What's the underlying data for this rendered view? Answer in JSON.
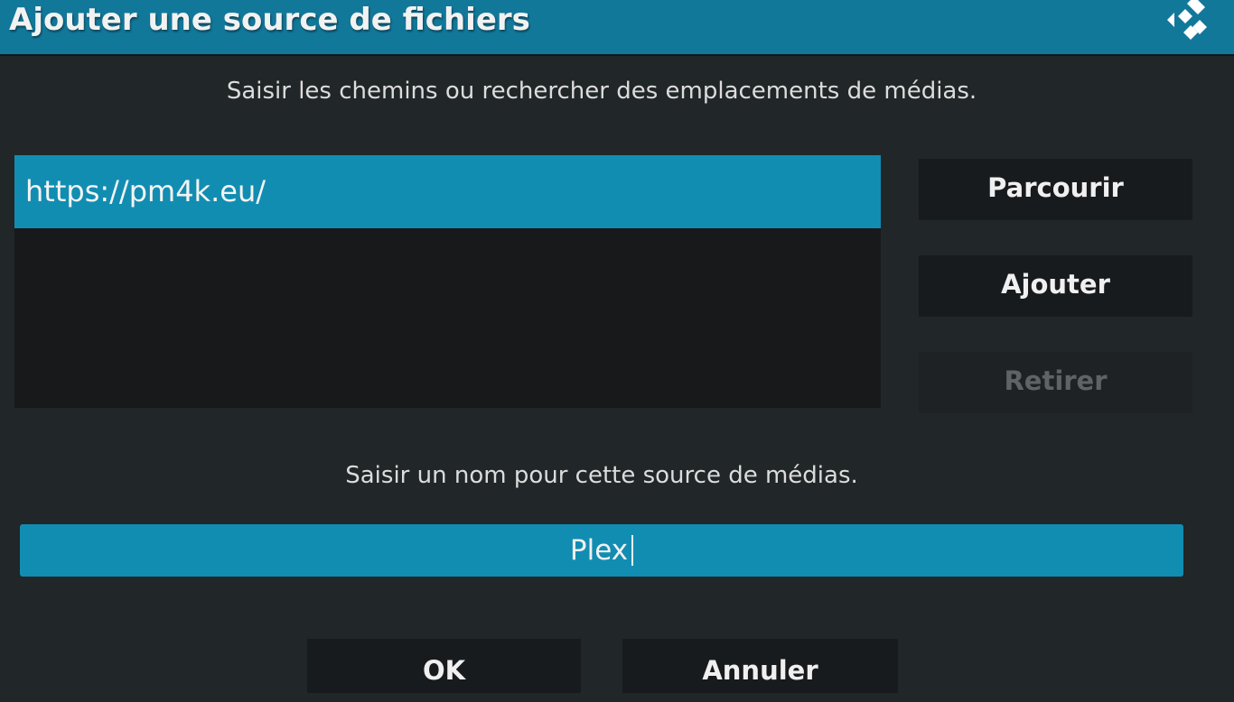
{
  "dialog": {
    "title": "Ajouter une source de fichiers",
    "header_color": "#12789a",
    "accent_color": "#128db2",
    "logo_icon": "kodi-logo-icon"
  },
  "paths": {
    "instruction": "Saisir les chemins ou rechercher des emplacements de médias.",
    "items": [
      {
        "value": "https://pm4k.eu/",
        "selected": true
      }
    ]
  },
  "side_buttons": {
    "browse": "Parcourir",
    "add": "Ajouter",
    "remove": "Retirer",
    "remove_disabled": true
  },
  "name": {
    "instruction": "Saisir un nom pour cette source de médias.",
    "value": "Plex"
  },
  "footer": {
    "ok": "OK",
    "cancel": "Annuler"
  }
}
